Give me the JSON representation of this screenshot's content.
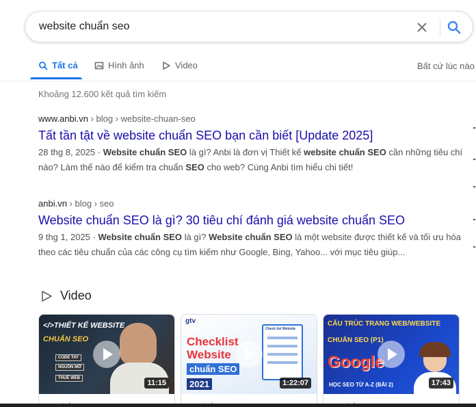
{
  "search": {
    "query": "website chuẩn seo",
    "clear_icon": "close-icon",
    "search_icon": "search-icon"
  },
  "tabs": [
    {
      "label": "Tất cả",
      "icon": "search-icon",
      "active": true
    },
    {
      "label": "Hình ảnh",
      "icon": "image-icon",
      "active": false
    },
    {
      "label": "Video",
      "icon": "play-icon",
      "active": false
    }
  ],
  "time_filter": "Bất cứ lúc nào",
  "result_count": "Khoảng 12.600 kết quả tìm kiếm",
  "results": [
    {
      "domain": "www.anbi.vn",
      "path": " › blog › website-chuan-seo",
      "title": "Tất tần tật về website chuẩn SEO bạn cần biết [Update 2025]",
      "date": "28 thg 8, 2025 · ",
      "snippet_parts": [
        {
          "text": "Website chuẩn SEO",
          "bold": true
        },
        {
          "text": " là gì? Anbi là đơn vị Thiết kế ",
          "bold": false
        },
        {
          "text": "website chuẩn SEO",
          "bold": true
        },
        {
          "text": " cần những tiêu chí nào? Làm thế nào để kiểm tra chuẩn ",
          "bold": false
        },
        {
          "text": "SEO",
          "bold": true
        },
        {
          "text": " cho web? Cùng Anbi tìm hiểu chi tiết!",
          "bold": false
        }
      ]
    },
    {
      "domain": "anbi.vn",
      "path": " › blog › seo",
      "title": "Website chuẩn SEO là gì? 30 tiêu chí đánh giá website chuẩn SEO",
      "date": "9 thg 1, 2025 · ",
      "snippet_parts": [
        {
          "text": "Website chuẩn SEO",
          "bold": true
        },
        {
          "text": " là gì? ",
          "bold": false
        },
        {
          "text": "Website chuẩn SEO",
          "bold": true
        },
        {
          "text": " là một website được thiết kế và tối ưu hóa theo các tiêu chuẩn của các công cụ tìm kiếm như Google, Bing, Yahoo... với mục tiêu giúp...",
          "bold": false
        }
      ]
    }
  ],
  "videos": {
    "header": "Video",
    "items": [
      {
        "duration": "11:15",
        "source": "youtube.com",
        "thumb_lines": [
          "</>THIẾT KẾ WEBSITE",
          "CHUẨN SEO",
          "CODE TAY",
          "NGUỒN MỞ",
          "THUÊ WEB"
        ]
      },
      {
        "duration": "1:22:07",
        "source": "youtube.com",
        "thumb_lines": [
          "gtv",
          "Checklist",
          "Website",
          "chuẩn SEO",
          "2021",
          "Check list Website"
        ]
      },
      {
        "duration": "17:43",
        "source": "youtube.com",
        "thumb_lines": [
          "CẤU TRÚC TRANG WEB/WEBSITE",
          "CHUẨN SEO (P1)",
          "Google",
          "HỌC SEO TỪ A-Z (BÀI 2)"
        ]
      }
    ]
  },
  "colors": {
    "link": "#1a0dab",
    "accent": "#1a73e8",
    "snippet": "#4d5156"
  }
}
